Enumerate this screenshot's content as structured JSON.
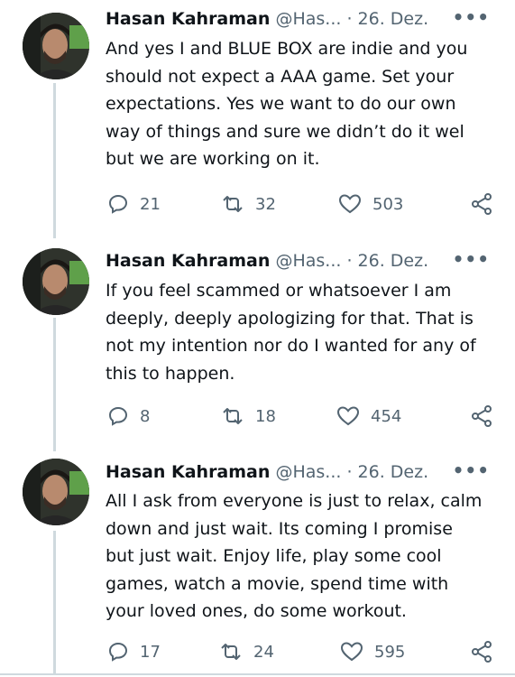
{
  "colors": {
    "text": "#0f1419",
    "secondary": "#536471",
    "thread_line": "#cfd9de"
  },
  "tweets": [
    {
      "name": "Hasan Kahraman",
      "handle": "@Has...",
      "separator": "·",
      "date": "26. Dez.",
      "more_icon": "more-horizontal-icon",
      "text": "And yes I and BLUE BOX are indie and you\nshould not expect a AAA game. Set your\nexpectations. Yes we want to do our own\nway of things and sure we didn’t do it wel\nbut we are working on it.",
      "replies": "21",
      "retweets": "32",
      "likes": "503"
    },
    {
      "name": "Hasan Kahraman",
      "handle": "@Has...",
      "separator": "·",
      "date": "26. Dez.",
      "more_icon": "more-horizontal-icon",
      "text": "If you feel scammed or whatsoever I am\ndeeply, deeply apologizing for that. That is\nnot my intention nor do I wanted for any of\nthis to happen.",
      "replies": "8",
      "retweets": "18",
      "likes": "454"
    },
    {
      "name": "Hasan Kahraman",
      "handle": "@Has...",
      "separator": "·",
      "date": "26. Dez.",
      "more_icon": "more-horizontal-icon",
      "text": "All I ask from everyone is just to relax, calm\ndown and just wait. Its coming I promise\nbut just wait. Enjoy life, play some cool\ngames, watch a movie, spend time with\nyour loved ones, do some workout.",
      "replies": "17",
      "retweets": "24",
      "likes": "595"
    }
  ]
}
